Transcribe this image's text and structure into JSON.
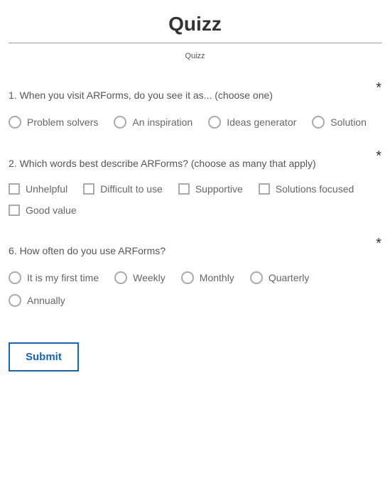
{
  "title": "Quizz",
  "subtitle": "Quizz",
  "required_marker": "*",
  "questions": [
    {
      "number": "1",
      "text": "When you visit ARForms, do you see it as... (choose one)",
      "type": "radio",
      "required": true,
      "options": [
        "Problem solvers",
        "An inspiration",
        "Ideas generator",
        "Solution"
      ]
    },
    {
      "number": "2",
      "text": "Which words best describe ARForms? (choose as many that apply)",
      "type": "checkbox",
      "required": true,
      "options": [
        "Unhelpful",
        "Difficult to use",
        "Supportive",
        "Solutions focused",
        "Good value"
      ]
    },
    {
      "number": "6",
      "text": "How often do you use ARForms?",
      "type": "radio",
      "required": true,
      "options": [
        "It is my first time",
        "Weekly",
        "Monthly",
        "Quarterly",
        "Annually"
      ]
    }
  ],
  "submit_label": "Submit"
}
